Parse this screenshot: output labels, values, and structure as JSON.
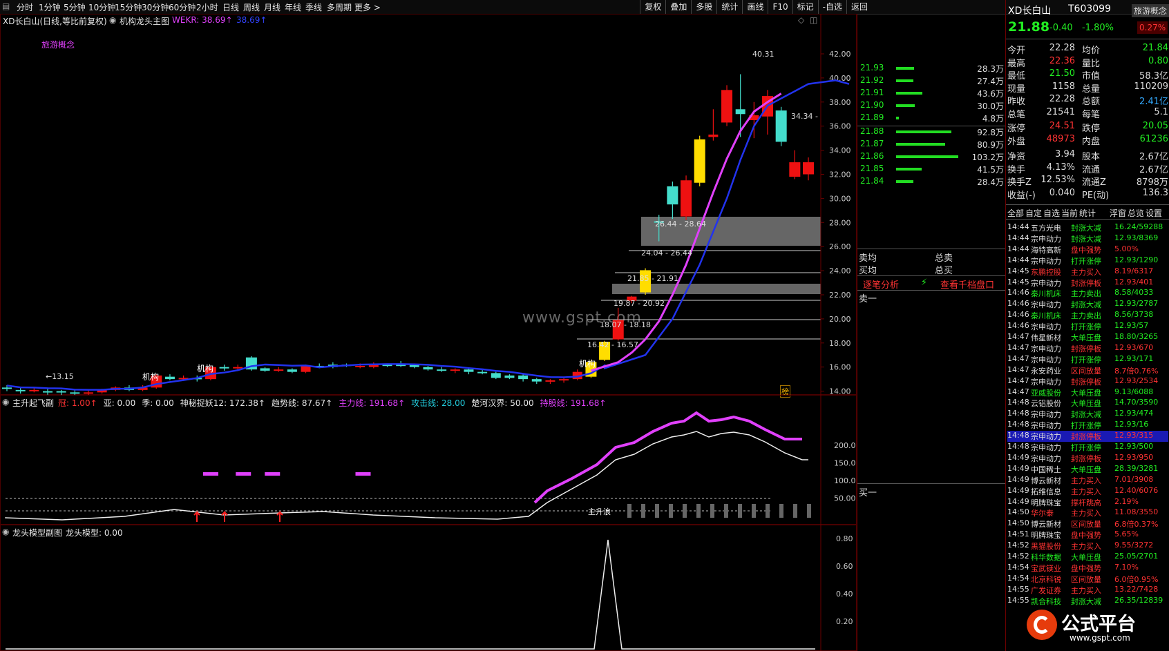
{
  "toolbar": {
    "periods": [
      "分时",
      "1分钟",
      "5分钟",
      "10分钟",
      "15分钟",
      "30分钟",
      "60分钟",
      "2小时",
      "日线",
      "周线",
      "月线",
      "年线",
      "季线",
      "多周期",
      "更多 >"
    ],
    "actions": [
      "复权",
      "叠加",
      "多股",
      "统计",
      "画线",
      "F10",
      "标记",
      "-自选",
      "返回"
    ]
  },
  "main_chart": {
    "title": "XD长白山(日线,等比前复权)",
    "indicator": "机构龙头主图",
    "wekr_label": "WEKR: 38.69↑",
    "wekr2_label": "38.69↑",
    "concept": "旅游概念",
    "watermark": "www.gspt.com",
    "y_ticks": [
      "42.00",
      "40.00",
      "38.00",
      "36.00",
      "34.00",
      "32.00",
      "30.00",
      "28.00",
      "26.00",
      "24.00",
      "22.00",
      "20.00",
      "18.00",
      "16.00",
      "14.00"
    ],
    "y_values": [
      42,
      40,
      38,
      36,
      34,
      32,
      30,
      28,
      26,
      24,
      22,
      20,
      18,
      16,
      14
    ],
    "annotations": {
      "low": "←13.15",
      "high": "40.31",
      "right_mark": "34.34 -",
      "zone1": "26.44 - 28.64",
      "zone2": "24.04 - 26.44",
      "zone3": "21.85 - 21.91",
      "zone4": "19.87 - 20.92",
      "zone5": "18.07 - 18.18",
      "zone6": "16.42 - 16.57",
      "jigou": "机构",
      "bang": "榜"
    },
    "candles": [
      {
        "o": 14.2,
        "c": 14.3,
        "h": 14.5,
        "l": 14.0,
        "t": "g"
      },
      {
        "o": 14.1,
        "c": 14.0,
        "h": 14.3,
        "l": 13.8,
        "t": "g"
      },
      {
        "o": 14.0,
        "c": 14.1,
        "h": 14.3,
        "l": 13.9,
        "t": "r"
      },
      {
        "o": 14.0,
        "c": 13.9,
        "h": 14.2,
        "l": 13.7,
        "t": "g"
      },
      {
        "o": 13.9,
        "c": 14.0,
        "h": 14.1,
        "l": 13.15,
        "t": "g"
      },
      {
        "o": 13.9,
        "c": 13.8,
        "h": 14.1,
        "l": 13.6,
        "t": "g"
      },
      {
        "o": 13.8,
        "c": 13.9,
        "h": 14.1,
        "l": 13.6,
        "t": "r"
      },
      {
        "o": 13.9,
        "c": 14.1,
        "h": 14.2,
        "l": 13.8,
        "t": "r"
      },
      {
        "o": 14.1,
        "c": 14.3,
        "h": 14.4,
        "l": 14.0,
        "t": "r"
      },
      {
        "o": 14.3,
        "c": 14.1,
        "h": 14.5,
        "l": 14.0,
        "t": "g"
      },
      {
        "o": 14.1,
        "c": 14.3,
        "h": 14.5,
        "l": 14.0,
        "t": "r"
      },
      {
        "o": 14.3,
        "c": 15.3,
        "h": 15.4,
        "l": 14.2,
        "t": "r"
      },
      {
        "o": 15.2,
        "c": 15.0,
        "h": 15.4,
        "l": 14.9,
        "t": "g"
      },
      {
        "o": 15.0,
        "c": 15.1,
        "h": 15.3,
        "l": 14.9,
        "t": "r"
      },
      {
        "o": 15.1,
        "c": 15.0,
        "h": 15.3,
        "l": 14.8,
        "t": "g"
      },
      {
        "o": 15.0,
        "c": 16.0,
        "h": 16.1,
        "l": 14.9,
        "t": "r"
      },
      {
        "o": 16.0,
        "c": 15.9,
        "h": 16.2,
        "l": 15.7,
        "t": "g"
      },
      {
        "o": 15.9,
        "c": 16.0,
        "h": 16.2,
        "l": 15.8,
        "t": "r"
      },
      {
        "o": 15.8,
        "c": 16.8,
        "h": 16.9,
        "l": 15.7,
        "t": "g"
      },
      {
        "o": 15.9,
        "c": 15.7,
        "h": 16.0,
        "l": 15.6,
        "t": "g"
      },
      {
        "o": 15.7,
        "c": 15.8,
        "h": 16.0,
        "l": 15.6,
        "t": "r"
      },
      {
        "o": 15.8,
        "c": 15.6,
        "h": 15.9,
        "l": 15.5,
        "t": "g"
      },
      {
        "o": 15.6,
        "c": 16.1,
        "h": 16.2,
        "l": 15.5,
        "t": "r"
      },
      {
        "o": 16.1,
        "c": 16.0,
        "h": 16.3,
        "l": 15.9,
        "t": "g"
      },
      {
        "o": 16.0,
        "c": 16.2,
        "h": 16.4,
        "l": 15.9,
        "t": "g"
      },
      {
        "o": 16.2,
        "c": 16.1,
        "h": 16.3,
        "l": 16.0,
        "t": "g"
      },
      {
        "o": 16.1,
        "c": 16.0,
        "h": 16.3,
        "l": 15.9,
        "t": "r"
      },
      {
        "o": 16.0,
        "c": 16.2,
        "h": 16.4,
        "l": 15.9,
        "t": "r"
      },
      {
        "o": 16.2,
        "c": 16.1,
        "h": 16.3,
        "l": 16.0,
        "t": "g"
      },
      {
        "o": 16.1,
        "c": 16.2,
        "h": 16.5,
        "l": 16.0,
        "t": "g"
      },
      {
        "o": 16.2,
        "c": 16.0,
        "h": 16.3,
        "l": 15.9,
        "t": "g"
      },
      {
        "o": 16.0,
        "c": 15.8,
        "h": 16.1,
        "l": 15.7,
        "t": "g"
      },
      {
        "o": 15.8,
        "c": 15.7,
        "h": 16.0,
        "l": 15.6,
        "t": "g"
      },
      {
        "o": 15.7,
        "c": 15.8,
        "h": 15.9,
        "l": 15.5,
        "t": "r"
      },
      {
        "o": 15.8,
        "c": 15.6,
        "h": 15.9,
        "l": 15.4,
        "t": "g"
      },
      {
        "o": 15.6,
        "c": 15.5,
        "h": 15.8,
        "l": 15.4,
        "t": "g"
      },
      {
        "o": 15.5,
        "c": 15.1,
        "h": 15.6,
        "l": 15.0,
        "t": "g"
      },
      {
        "o": 15.1,
        "c": 15.3,
        "h": 15.4,
        "l": 15.0,
        "t": "g"
      },
      {
        "o": 15.3,
        "c": 15.0,
        "h": 15.4,
        "l": 14.8,
        "t": "g"
      },
      {
        "o": 15.0,
        "c": 14.8,
        "h": 15.1,
        "l": 14.6,
        "t": "g"
      },
      {
        "o": 14.8,
        "c": 14.9,
        "h": 15.0,
        "l": 14.6,
        "t": "r"
      },
      {
        "o": 14.9,
        "c": 15.0,
        "h": 15.1,
        "l": 14.7,
        "t": "r"
      },
      {
        "o": 15.0,
        "c": 15.6,
        "h": 15.8,
        "l": 14.9,
        "t": "r"
      },
      {
        "o": 15.2,
        "c": 16.42,
        "h": 16.57,
        "l": 15.1,
        "t": "y"
      },
      {
        "o": 16.6,
        "c": 18.1,
        "h": 18.18,
        "l": 16.5,
        "t": "y"
      },
      {
        "o": 18.3,
        "c": 19.9,
        "h": 20.92,
        "l": 18.2,
        "t": "r"
      },
      {
        "o": 21.5,
        "c": 21.85,
        "h": 21.91,
        "l": 21.3,
        "t": "r"
      },
      {
        "o": 22.2,
        "c": 24.04,
        "h": 24.2,
        "l": 22.0,
        "t": "y"
      },
      {
        "o": 28.0,
        "c": 28.1,
        "h": 28.64,
        "l": 26.44,
        "t": "g"
      },
      {
        "o": 31.0,
        "c": 29.5,
        "h": 31.4,
        "l": 28.3,
        "t": "g"
      },
      {
        "o": 28.5,
        "c": 31.5,
        "h": 31.9,
        "l": 28.2,
        "t": "r"
      },
      {
        "o": 31.3,
        "c": 34.9,
        "h": 35.2,
        "l": 31.0,
        "t": "y"
      },
      {
        "o": 35.1,
        "c": 35.3,
        "h": 37.4,
        "l": 34.8,
        "t": "r"
      },
      {
        "o": 36.3,
        "c": 39.0,
        "h": 39.4,
        "l": 36.0,
        "t": "r"
      },
      {
        "o": 37.0,
        "c": 37.4,
        "h": 40.31,
        "l": 35.1,
        "t": "g"
      },
      {
        "o": 36.9,
        "c": 36.5,
        "h": 38.0,
        "l": 35.0,
        "t": "r"
      },
      {
        "o": 36.8,
        "c": 38.5,
        "h": 39.0,
        "l": 35.3,
        "t": "r"
      },
      {
        "o": 37.3,
        "c": 34.7,
        "h": 37.6,
        "l": 34.34,
        "t": "g"
      },
      {
        "o": 33.0,
        "c": 31.8,
        "h": 34.0,
        "l": 31.6,
        "t": "r"
      },
      {
        "o": 32.0,
        "c": 33.0,
        "h": 33.4,
        "l": 31.5,
        "t": "r"
      }
    ]
  },
  "sub1": {
    "name": "主升起飞副",
    "labels": [
      {
        "t": "冠: 1.00↑",
        "c": "#ff3333"
      },
      {
        "t": "亚: 0.00",
        "c": "#e6e6e6"
      },
      {
        "t": "季: 0.00",
        "c": "#e6e6e6"
      },
      {
        "t": "神秘捉妖12: 172.38↑",
        "c": "#e6e6e6"
      },
      {
        "t": "趋势线: 87.67↑",
        "c": "#e6e6e6"
      },
      {
        "t": "主力线: 191.68↑",
        "c": "#e040fb"
      },
      {
        "t": "攻击线: 28.00",
        "c": "#22ccdd"
      },
      {
        "t": "楚河汉界: 50.00",
        "c": "#e6e6e6"
      },
      {
        "t": "持股线: 191.68↑",
        "c": "#e040fb"
      }
    ],
    "y_ticks": [
      "200.0",
      "150.0",
      "100.0",
      "50.00"
    ],
    "y_values": [
      200,
      150,
      100,
      50
    ],
    "zhusheng_label": "主升浪"
  },
  "sub2": {
    "name": "龙头模型副图",
    "value_label": "龙头模型: 0.00",
    "y_ticks": [
      "0.80",
      "0.60",
      "0.40",
      "0.20"
    ],
    "y_values": [
      0.8,
      0.6,
      0.4,
      0.2
    ]
  },
  "orderbook": {
    "asks": [
      {
        "p": "21.93",
        "v": "28.3万",
        "w": 26
      },
      {
        "p": "21.92",
        "v": "27.4万",
        "w": 25
      },
      {
        "p": "21.91",
        "v": "43.6万",
        "w": 38
      },
      {
        "p": "21.90",
        "v": "30.0万",
        "w": 27
      },
      {
        "p": "21.89",
        "v": "4.8万",
        "w": 4
      }
    ],
    "bids": [
      {
        "p": "21.88",
        "v": "92.8万",
        "w": 80
      },
      {
        "p": "21.87",
        "v": "80.9万",
        "w": 71
      },
      {
        "p": "21.86",
        "v": "103.2万",
        "w": 90
      },
      {
        "p": "21.85",
        "v": "41.5万",
        "w": 37
      },
      {
        "p": "21.84",
        "v": "28.4万",
        "w": 25
      }
    ],
    "sell_avg": "卖均",
    "buy_avg": "买均",
    "total_sell": "总卖",
    "total_buy": "总买",
    "analysis_btn": "逐笔分析",
    "depth_btn": "查看千档盘口",
    "sell1": "卖一",
    "buy1": "买一"
  },
  "info": {
    "name": "XD长白山",
    "code": "T603099",
    "concept_badge": "旅游概念",
    "price": "21.88",
    "change": "-0.40",
    "pct": "-1.80%",
    "small_pct": "0.27%",
    "rows": [
      {
        "a": "今开",
        "b": "22.28",
        "bc": "#ddd",
        "c": "均价",
        "d": "21.84",
        "dc": "#22ee22"
      },
      {
        "a": "最高",
        "b": "22.36",
        "bc": "#ff3333",
        "c": "量比",
        "d": "0.80",
        "dc": "#22ee22"
      },
      {
        "a": "最低",
        "b": "21.50",
        "bc": "#22ee22",
        "c": "市值",
        "d": "58.3亿",
        "dc": "#ddd"
      },
      {
        "a": "现量",
        "b": "1158",
        "bc": "#ddd",
        "c": "总量",
        "d": "110209",
        "dc": "#ddd"
      },
      {
        "a": "昨收",
        "b": "22.28",
        "bc": "#ddd",
        "c": "总额",
        "d": "2.41亿",
        "dc": "#33aaff"
      },
      {
        "a": "总笔",
        "b": "21541",
        "bc": "#ddd",
        "c": "每笔",
        "d": "5.1",
        "dc": "#ddd"
      },
      {
        "a": "涨停",
        "b": "24.51",
        "bc": "#ff3333",
        "c": "跌停",
        "d": "20.05",
        "dc": "#22ee22"
      },
      {
        "a": "外盘",
        "b": "48973",
        "bc": "#ff3333",
        "c": "内盘",
        "d": "61236",
        "dc": "#22ee22"
      },
      {
        "a": "净资",
        "b": "3.94",
        "bc": "#ddd",
        "c": "股本",
        "d": "2.67亿",
        "dc": "#ddd"
      },
      {
        "a": "换手",
        "b": "4.13%",
        "bc": "#ddd",
        "c": "流通",
        "d": "2.67亿",
        "dc": "#ddd"
      },
      {
        "a": "换手Z",
        "b": "12.53%",
        "bc": "#ddd",
        "c": "流通Z",
        "d": "8798万",
        "dc": "#ddd"
      },
      {
        "a": "收益(-)",
        "b": "0.040",
        "bc": "#ddd",
        "c": "PE(动)",
        "d": "136.3",
        "dc": "#ddd"
      }
    ],
    "tabs": [
      "全部",
      "自定",
      "自选",
      "当前",
      "统计",
      "浮窗",
      "总览",
      "设置"
    ],
    "trades": [
      {
        "t": "14:44",
        "s": "五方光电",
        "e": "封涨大减",
        "v": "16.24/59288",
        "c": "#ddd",
        "ec": "#22ee22"
      },
      {
        "t": "14:44",
        "s": "宗申动力",
        "e": "封涨大减",
        "v": "12.93/8369",
        "c": "#ddd",
        "ec": "#22ee22"
      },
      {
        "t": "14:44",
        "s": "海特高新",
        "e": "盘中强势",
        "v": "5.00%",
        "c": "#ddd",
        "ec": "#ff3333"
      },
      {
        "t": "14:44",
        "s": "宗申动力",
        "e": "打开涨停",
        "v": "12.93/1290",
        "c": "#ddd",
        "ec": "#22ee22"
      },
      {
        "t": "14:45",
        "s": "东鹏控股",
        "e": "主力买入",
        "v": "8.19/6317",
        "c": "#ff3333",
        "ec": "#ff3333"
      },
      {
        "t": "14:45",
        "s": "宗申动力",
        "e": "封涨停板",
        "v": "12.93/401",
        "c": "#ddd",
        "ec": "#ff3333"
      },
      {
        "t": "14:46",
        "s": "秦川机床",
        "e": "主力卖出",
        "v": "8.58/4033",
        "c": "#22ee22",
        "ec": "#22ee22"
      },
      {
        "t": "14:46",
        "s": "宗申动力",
        "e": "封涨大减",
        "v": "12.93/2787",
        "c": "#ddd",
        "ec": "#22ee22"
      },
      {
        "t": "14:46",
        "s": "秦川机床",
        "e": "主力卖出",
        "v": "8.56/3738",
        "c": "#22ee22",
        "ec": "#22ee22"
      },
      {
        "t": "14:46",
        "s": "宗申动力",
        "e": "打开涨停",
        "v": "12.93/57",
        "c": "#ddd",
        "ec": "#22ee22"
      },
      {
        "t": "14:47",
        "s": "伟星新材",
        "e": "大单压盘",
        "v": "18.80/3265",
        "c": "#ddd",
        "ec": "#22ee22"
      },
      {
        "t": "14:47",
        "s": "宗申动力",
        "e": "封涨停板",
        "v": "12.93/670",
        "c": "#ddd",
        "ec": "#ff3333"
      },
      {
        "t": "14:47",
        "s": "宗申动力",
        "e": "打开涨停",
        "v": "12.93/171",
        "c": "#ddd",
        "ec": "#22ee22"
      },
      {
        "t": "14:47",
        "s": "永安药业",
        "e": "区间放量",
        "v": "8.7倍0.76%",
        "c": "#ddd",
        "ec": "#ff3333"
      },
      {
        "t": "14:47",
        "s": "宗申动力",
        "e": "封涨停板",
        "v": "12.93/2534",
        "c": "#ddd",
        "ec": "#ff3333"
      },
      {
        "t": "14:47",
        "s": "亚威股份",
        "e": "大单压盘",
        "v": "9.13/6088",
        "c": "#22ee22",
        "ec": "#22ee22"
      },
      {
        "t": "14:48",
        "s": "云铝股份",
        "e": "大单压盘",
        "v": "14.70/3590",
        "c": "#ddd",
        "ec": "#22ee22"
      },
      {
        "t": "14:48",
        "s": "宗申动力",
        "e": "封涨大减",
        "v": "12.93/474",
        "c": "#ddd",
        "ec": "#22ee22"
      },
      {
        "t": "14:48",
        "s": "宗申动力",
        "e": "打开涨停",
        "v": "12.93/16",
        "c": "#ddd",
        "ec": "#22ee22"
      },
      {
        "t": "14:48",
        "s": "宗申动力",
        "e": "封涨停板",
        "v": "12.93/315",
        "c": "#ddd",
        "ec": "#ff3333",
        "hl": true
      },
      {
        "t": "14:48",
        "s": "宗申动力",
        "e": "打开涨停",
        "v": "12.93/500",
        "c": "#ddd",
        "ec": "#22ee22"
      },
      {
        "t": "14:49",
        "s": "宗申动力",
        "e": "封涨停板",
        "v": "12.93/950",
        "c": "#ddd",
        "ec": "#ff3333"
      },
      {
        "t": "14:49",
        "s": "中国稀土",
        "e": "大单压盘",
        "v": "28.39/3281",
        "c": "#ddd",
        "ec": "#22ee22"
      },
      {
        "t": "14:49",
        "s": "博云新材",
        "e": "主力买入",
        "v": "7.01/3908",
        "c": "#ddd",
        "ec": "#ff3333"
      },
      {
        "t": "14:49",
        "s": "拓维信息",
        "e": "主力买入",
        "v": "12.40/6076",
        "c": "#ddd",
        "ec": "#ff3333"
      },
      {
        "t": "14:49",
        "s": "明牌珠宝",
        "e": "撑杆跳高",
        "v": "2.19%",
        "c": "#ddd",
        "ec": "#ff3333"
      },
      {
        "t": "14:50",
        "s": "华尔泰",
        "e": "主力买入",
        "v": "11.08/3550",
        "c": "#ff3333",
        "ec": "#ff3333"
      },
      {
        "t": "14:50",
        "s": "博云新材",
        "e": "区间放量",
        "v": "6.8倍0.37%",
        "c": "#ddd",
        "ec": "#ff3333"
      },
      {
        "t": "14:51",
        "s": "明牌珠宝",
        "e": "盘中强势",
        "v": "5.65%",
        "c": "#ddd",
        "ec": "#ff3333"
      },
      {
        "t": "14:52",
        "s": "黑猫股份",
        "e": "主力买入",
        "v": "9.55/3272",
        "c": "#ff3333",
        "ec": "#ff3333"
      },
      {
        "t": "14:52",
        "s": "科华数据",
        "e": "大单压盘",
        "v": "25.05/2701",
        "c": "#22ee22",
        "ec": "#22ee22"
      },
      {
        "t": "14:54",
        "s": "宝武镁业",
        "e": "盘中强势",
        "v": "7.10%",
        "c": "#ff3333",
        "ec": "#ff3333"
      },
      {
        "t": "14:54",
        "s": "北京科锐",
        "e": "区间放量",
        "v": "6.0倍0.95%",
        "c": "#ff3333",
        "ec": "#ff3333"
      },
      {
        "t": "14:55",
        "s": "广发证券",
        "e": "主力买入",
        "v": "13.22/7428",
        "c": "#ff3333",
        "ec": "#ff3333"
      },
      {
        "t": "14:55",
        "s": "凯合科技",
        "e": "封涨大减",
        "v": "26.35/12839",
        "c": "#22ee22",
        "ec": "#22ee22"
      }
    ],
    "logo_text": "公式平台",
    "logo_url": "www.gspt.com"
  }
}
